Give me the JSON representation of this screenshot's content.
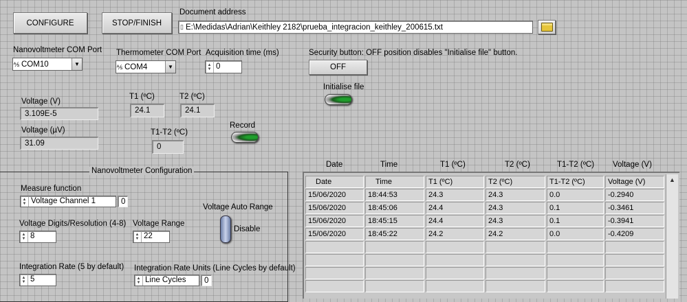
{
  "toolbar": {
    "configure_label": "CONFIGURE",
    "stop_label": "STOP/FINISH",
    "document_address_label": "Document address",
    "document_address_value": "E:\\Medidas\\Adrian\\Keithley 2182\\prueba_integracion_keithley_200615.txt"
  },
  "com": {
    "nano_label": "Nanovoltmeter COM Port",
    "nano_value": "COM10",
    "thermo_label": "Thermometer COM Port",
    "thermo_value": "COM4",
    "acq_label": "Acquisition time (ms)",
    "acq_value": "0"
  },
  "security": {
    "label": "Security button: OFF position disables \"Initialise file\" button.",
    "button_label": "OFF",
    "initialise_label": "Initialise file"
  },
  "readings": {
    "voltage_v_label": "Voltage (V)",
    "voltage_v_value": "3.109E-5",
    "voltage_uv_label": "Voltage (µV)",
    "voltage_uv_value": "31.09",
    "t1_label": "T1 (ºC)",
    "t1_value": "24.1",
    "t2_label": "T2 (ºC)",
    "t2_value": "24.1",
    "diff_label": "T1-T2 (ºC)",
    "diff_value": "0",
    "record_label": "Record"
  },
  "config": {
    "title": "Nanovoltmeter Configuration",
    "measure_label": "Measure function",
    "measure_value": "Voltage Channel 1",
    "measure_index": "0",
    "digits_label": "Voltage Digits/Resolution (4-8)",
    "digits_value": "8",
    "range_label": "Voltage Range",
    "range_value": "22",
    "autorange_label": "Voltage Auto Range",
    "autorange_state": "Disable",
    "rate_label": "Integration Rate (5 by default)",
    "rate_value": "5",
    "units_label": "Integration Rate Units (Line Cycles by default)",
    "units_value": "Line Cycles",
    "units_index": "0"
  },
  "table": {
    "outer_headers": [
      "Date",
      "Time",
      "T1 (ºC)",
      "T2 (ºC)",
      "T1-T2 (ºC)",
      "Voltage (V)"
    ],
    "inner_headers": [
      "Date",
      "Time",
      "T1 (ºC)",
      "T2 (ºC)",
      "T1-T2 (ºC)",
      "Voltage (V)"
    ],
    "rows": [
      [
        "15/06/2020",
        "18:44:53",
        "24.3",
        "24.3",
        "0.0",
        "-0.2940"
      ],
      [
        "15/06/2020",
        "18:45:06",
        "24.4",
        "24.3",
        "0.1",
        "-0.3461"
      ],
      [
        "15/06/2020",
        "18:45:15",
        "24.4",
        "24.3",
        "0.1",
        "-0.3941"
      ],
      [
        "15/06/2020",
        "18:45:22",
        "24.2",
        "24.2",
        "0.0",
        "-0.4209"
      ]
    ]
  }
}
